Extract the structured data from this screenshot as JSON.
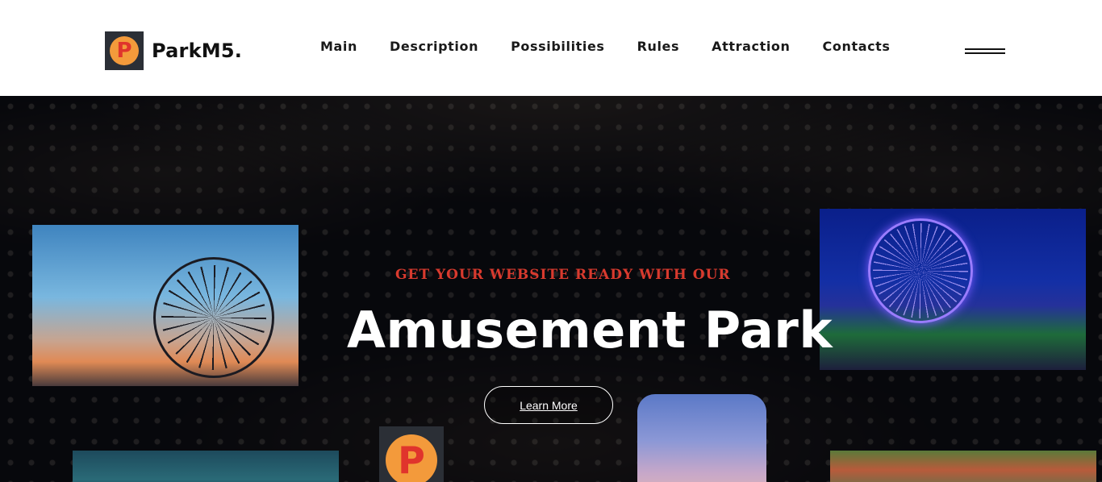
{
  "brand": {
    "logo_letter": "P",
    "name": "ParkM5."
  },
  "nav": {
    "items": [
      {
        "label": "Main"
      },
      {
        "label": "Description"
      },
      {
        "label": "Possibilities"
      },
      {
        "label": "Rules"
      },
      {
        "label": "Attraction"
      },
      {
        "label": "Contacts"
      }
    ]
  },
  "hero": {
    "kicker": "GET YOUR WEBSITE READY WITH OUR",
    "title": "Amusement Park",
    "cta_label": "Learn More"
  },
  "colors": {
    "accent_red": "#d83a2e",
    "logo_orange": "#f39a3b",
    "logo_bg": "#2b2f36",
    "hero_bg": "#0b0c10"
  }
}
